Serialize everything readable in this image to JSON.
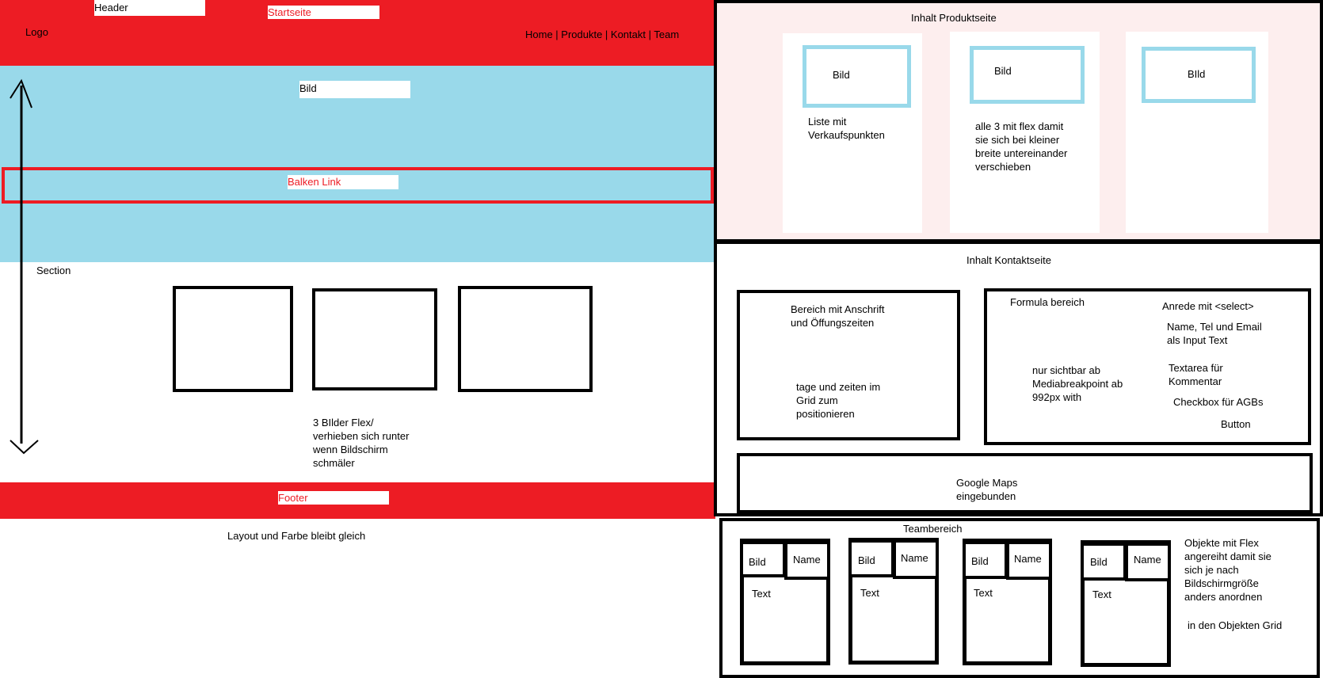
{
  "left": {
    "header_label": "Header",
    "startseite_label": "Startseite",
    "logo": "Logo",
    "nav": "Home | Produkte | Kontakt | Team",
    "hero_label": "Bild",
    "balken_label": "Balken Link",
    "section_label": "Section",
    "flex_note": "3 BIlder Flex/\nverhieben sich runter\nwenn Bildschirm\nschmäler",
    "footer_label": "Footer",
    "layout_note": "Layout und Farbe bleibt gleich"
  },
  "produkt": {
    "title": "Inhalt Produktseite",
    "cards": [
      {
        "image": "Bild",
        "text": "Liste mit\nVerkaufspunkten"
      },
      {
        "image": "Bild",
        "text": "alle 3 mit flex damit\nsie sich bei kleiner\nbreite untereinander\nverschieben"
      },
      {
        "image": "BIld",
        "text": ""
      }
    ]
  },
  "kontakt": {
    "title": "Inhalt Kontaktseite",
    "address_box": {
      "text1": "Bereich mit Anschrift\nund Öffungszeiten",
      "text2": "tage und zeiten im\nGrid zum\npositionieren"
    },
    "form_box": {
      "title": "Formula bereich",
      "visibility_note": "nur sichtbar ab\nMediabreakpoint ab\n992px with",
      "anrede": "Anrede mit <select>",
      "inputs": "Name, Tel und Email\nals Input Text",
      "textarea": "Textarea  für\nKommentar",
      "checkbox": "Checkbox für AGBs",
      "button": "Button"
    },
    "maps": "Google Maps\neingebunden"
  },
  "team": {
    "title": "Teambereich",
    "cards": [
      {
        "image": "Bild",
        "name": "Name",
        "text": "Text"
      },
      {
        "image": "Bild",
        "name": "Name",
        "text": "Text"
      },
      {
        "image": "Bild",
        "name": "Name",
        "text": "Text"
      },
      {
        "image": "Bild",
        "name": "Name",
        "text": "Text"
      }
    ],
    "note": "Objekte mit Flex\nangereiht damit sie\nsich je nach\nBildschirmgröße\nanders anordnen",
    "note2": "in den Objekten Grid"
  },
  "colors": {
    "red": "#ed1c24",
    "light_blue": "#99d9ea",
    "pink_bg": "#fdeeee",
    "black": "#000000"
  }
}
